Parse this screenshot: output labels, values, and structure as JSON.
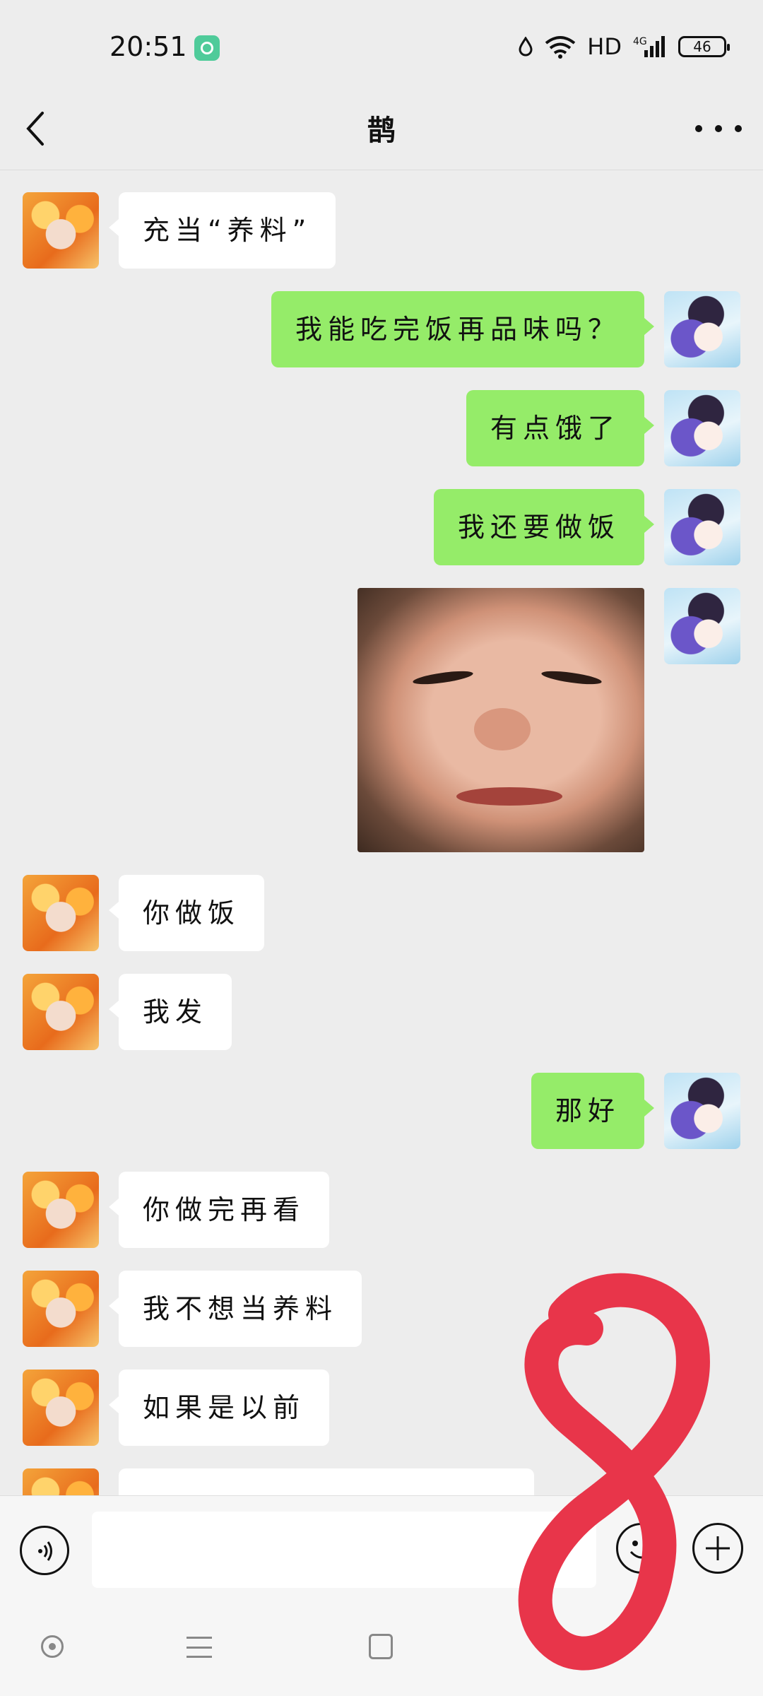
{
  "status_bar": {
    "time": "20:51",
    "network_label": "HD",
    "signal_label": "4G",
    "battery_level": "46"
  },
  "header": {
    "title": "鹊",
    "back_icon": "chevron-left-icon",
    "more_icon": "more-horizontal-icon"
  },
  "messages": [
    {
      "side": "left",
      "text": "充当“养料”"
    },
    {
      "side": "right",
      "text": "我能吃完饭再品味吗？"
    },
    {
      "side": "right",
      "text": "有点饿了"
    },
    {
      "side": "right",
      "text": "我还要做饭"
    },
    {
      "side": "right",
      "type": "sticker"
    },
    {
      "side": "left",
      "text": "你做饭"
    },
    {
      "side": "left",
      "text": "我发"
    },
    {
      "side": "right",
      "text": "那好"
    },
    {
      "side": "left",
      "text": "你做完再看"
    },
    {
      "side": "left",
      "text": "我不想当养料"
    },
    {
      "side": "left",
      "text": "如果是以前"
    }
  ],
  "input_bar": {
    "voice_icon": "voice-icon",
    "emoji_icon": "emoji-icon",
    "plus_icon": "plus-icon",
    "placeholder": ""
  },
  "colors": {
    "background": "#ededed",
    "outgoing_bubble": "#95ec69",
    "incoming_bubble": "#ffffff",
    "annotation": "#e8354a"
  }
}
